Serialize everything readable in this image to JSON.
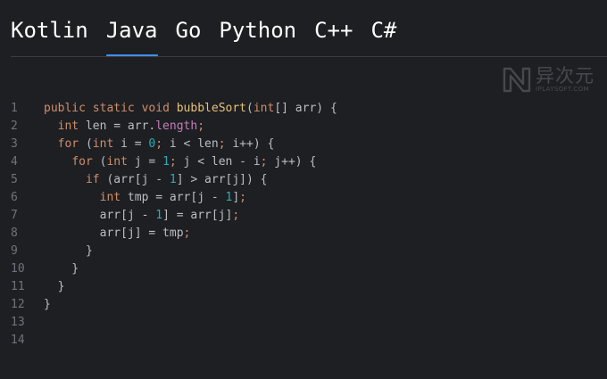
{
  "tabs": [
    {
      "label": "Kotlin",
      "active": false
    },
    {
      "label": "Java",
      "active": true
    },
    {
      "label": "Go",
      "active": false
    },
    {
      "label": "Python",
      "active": false
    },
    {
      "label": "C++",
      "active": false
    },
    {
      "label": "C#",
      "active": false
    }
  ],
  "watermark": {
    "name": "异次元",
    "sub": "IPLAYSOFT.COM",
    "logo": "n-logo-icon"
  },
  "colors": {
    "background": "#1e1f22",
    "accent": "#3f8fe8",
    "keyword": "#cf8e6d",
    "function": "#e8c17a",
    "field": "#c77dbb",
    "number": "#2aacb8",
    "text": "#bcbec4",
    "line_number": "#6f737a"
  },
  "editor": {
    "line_numbers": [
      "1",
      "2",
      "3",
      "4",
      "5",
      "6",
      "7",
      "8",
      "9",
      "10",
      "11",
      "12",
      "13",
      "14"
    ],
    "lines": [
      [
        {
          "t": "public",
          "c": "kw"
        },
        {
          "t": " ",
          "c": "pl"
        },
        {
          "t": "static",
          "c": "kw"
        },
        {
          "t": " ",
          "c": "pl"
        },
        {
          "t": "void",
          "c": "kw"
        },
        {
          "t": " ",
          "c": "pl"
        },
        {
          "t": "bubbleSort",
          "c": "fnb"
        },
        {
          "t": "(",
          "c": "pl"
        },
        {
          "t": "int",
          "c": "kw"
        },
        {
          "t": "[] arr) {",
          "c": "pl"
        }
      ],
      [
        {
          "t": "  ",
          "c": "pl"
        },
        {
          "t": "int",
          "c": "kw"
        },
        {
          "t": " len = arr.",
          "c": "pl"
        },
        {
          "t": "length",
          "c": "fld"
        },
        {
          "t": ";",
          "c": "sep"
        }
      ],
      [
        {
          "t": "  ",
          "c": "pl"
        },
        {
          "t": "for",
          "c": "kw"
        },
        {
          "t": " (",
          "c": "pl"
        },
        {
          "t": "int",
          "c": "kw"
        },
        {
          "t": " i = ",
          "c": "pl"
        },
        {
          "t": "0",
          "c": "num"
        },
        {
          "t": ";",
          "c": "sep"
        },
        {
          "t": " i < len",
          "c": "pl"
        },
        {
          "t": ";",
          "c": "sep"
        },
        {
          "t": " i++) {",
          "c": "pl"
        }
      ],
      [
        {
          "t": "    ",
          "c": "pl"
        },
        {
          "t": "for",
          "c": "kw"
        },
        {
          "t": " (",
          "c": "pl"
        },
        {
          "t": "int",
          "c": "kw"
        },
        {
          "t": " j = ",
          "c": "pl"
        },
        {
          "t": "1",
          "c": "num"
        },
        {
          "t": ";",
          "c": "sep"
        },
        {
          "t": " j < len - i",
          "c": "pl"
        },
        {
          "t": ";",
          "c": "sep"
        },
        {
          "t": " j++) {",
          "c": "pl"
        }
      ],
      [
        {
          "t": "      ",
          "c": "pl"
        },
        {
          "t": "if",
          "c": "kw"
        },
        {
          "t": " (arr[j - ",
          "c": "pl"
        },
        {
          "t": "1",
          "c": "num"
        },
        {
          "t": "] > arr[j]) {",
          "c": "pl"
        }
      ],
      [
        {
          "t": "        ",
          "c": "pl"
        },
        {
          "t": "int",
          "c": "kw"
        },
        {
          "t": " tmp = arr[j - ",
          "c": "pl"
        },
        {
          "t": "1",
          "c": "num"
        },
        {
          "t": "]",
          "c": "pl"
        },
        {
          "t": ";",
          "c": "sep"
        }
      ],
      [
        {
          "t": "        arr[j - ",
          "c": "pl"
        },
        {
          "t": "1",
          "c": "num"
        },
        {
          "t": "] = arr[j]",
          "c": "pl"
        },
        {
          "t": ";",
          "c": "sep"
        }
      ],
      [
        {
          "t": "        arr[j] = tmp",
          "c": "pl"
        },
        {
          "t": ";",
          "c": "sep"
        }
      ],
      [
        {
          "t": "      }",
          "c": "pl"
        }
      ],
      [
        {
          "t": "    }",
          "c": "pl"
        }
      ],
      [
        {
          "t": "  }",
          "c": "pl"
        }
      ],
      [
        {
          "t": "}",
          "c": "pl"
        }
      ],
      [],
      []
    ]
  }
}
